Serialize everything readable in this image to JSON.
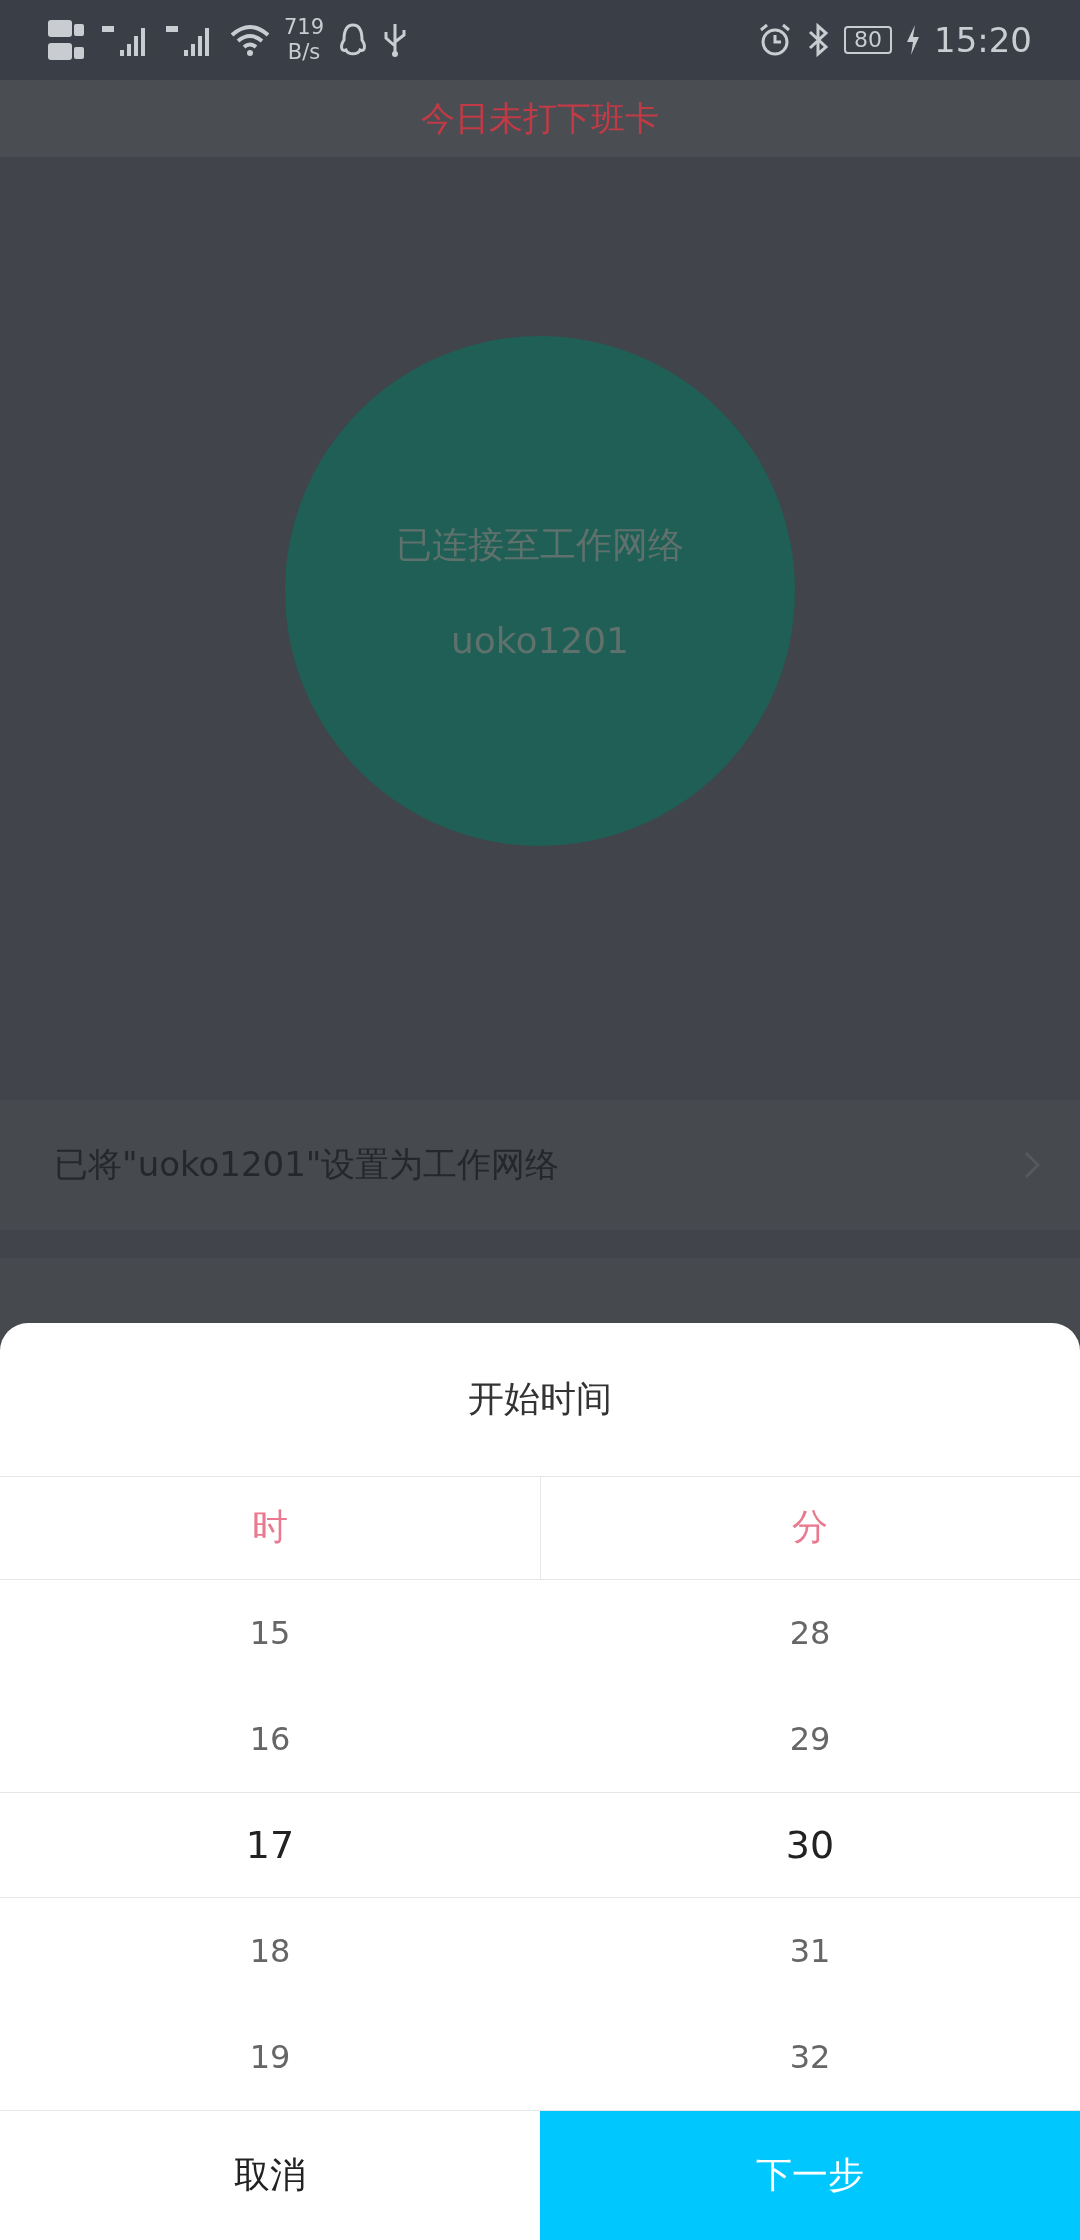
{
  "status_bar": {
    "speed_value": "719",
    "speed_unit": "B/s",
    "battery": "80",
    "time": "15:20"
  },
  "header": {
    "title": "今日未打下班卡"
  },
  "connection": {
    "line1": "已连接至工作网络",
    "line2": "uoko1201"
  },
  "settings": [
    {
      "label": "已将\"uoko1201\"设置为工作网络"
    }
  ],
  "picker": {
    "title": "开始时间",
    "columns": [
      {
        "header": "时",
        "values": [
          {
            "text": "15",
            "selected": false
          },
          {
            "text": "16",
            "selected": false
          },
          {
            "text": "17",
            "selected": true
          },
          {
            "text": "18",
            "selected": false
          },
          {
            "text": "19",
            "selected": false
          }
        ]
      },
      {
        "header": "分",
        "values": [
          {
            "text": "28",
            "selected": false
          },
          {
            "text": "29",
            "selected": false
          },
          {
            "text": "30",
            "selected": true
          },
          {
            "text": "31",
            "selected": false
          },
          {
            "text": "32",
            "selected": false
          }
        ]
      }
    ],
    "buttons": [
      {
        "label": "取消",
        "kind": "secondary"
      },
      {
        "label": "下一步",
        "kind": "primary"
      }
    ]
  }
}
